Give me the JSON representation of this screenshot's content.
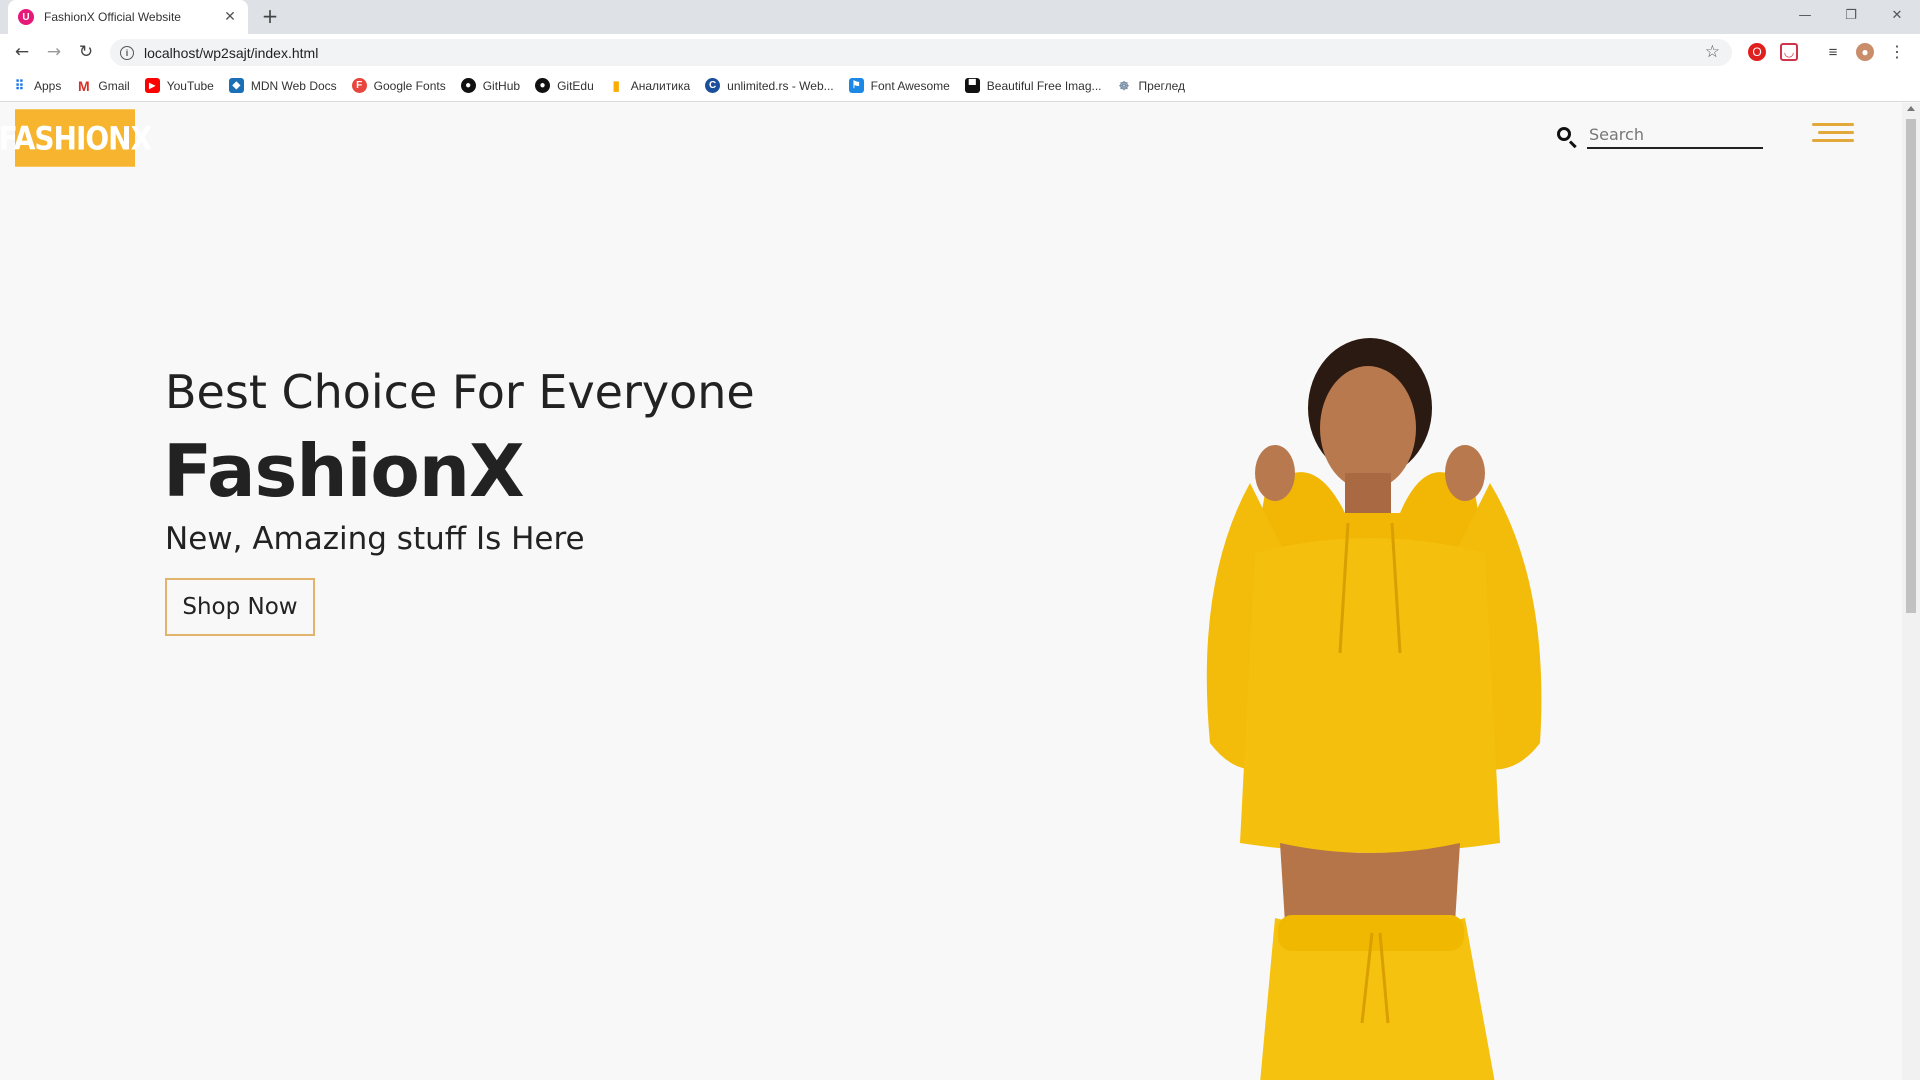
{
  "browser": {
    "tab_title": "FashionX Official Website",
    "tab_favicon_letter": "U",
    "url": "localhost/wp2sajt/index.html",
    "bookmarks": [
      {
        "label": "Apps",
        "icon": "apps-grid-icon",
        "color": "#1a73e8"
      },
      {
        "label": "Gmail",
        "icon": "gmail-icon",
        "color": "#d93025"
      },
      {
        "label": "YouTube",
        "icon": "youtube-icon",
        "color": "#ff0000"
      },
      {
        "label": "MDN Web Docs",
        "icon": "mdn-icon",
        "color": "#1b6fb5"
      },
      {
        "label": "Google Fonts",
        "icon": "google-fonts-icon",
        "color": "#e8453c"
      },
      {
        "label": "GitHub",
        "icon": "github-icon",
        "color": "#111111"
      },
      {
        "label": "GitEdu",
        "icon": "github-icon",
        "color": "#111111"
      },
      {
        "label": "Аналитика",
        "icon": "analytics-icon",
        "color": "#f9ab00"
      },
      {
        "label": "unlimited.rs - Web...",
        "icon": "unlimited-icon",
        "color": "#1b4f9c"
      },
      {
        "label": "Font Awesome",
        "icon": "font-awesome-icon",
        "color": "#1c88e5"
      },
      {
        "label": "Beautiful Free Imag...",
        "icon": "unsplash-icon",
        "color": "#111111"
      },
      {
        "label": "Преглед",
        "icon": "preview-icon",
        "color": "#7a8fa6"
      }
    ]
  },
  "site": {
    "logo_text": "FASHIONX",
    "brand_color": "#f7b52f",
    "accent_color": "#e2a83a",
    "search_placeholder": "Search"
  },
  "hero": {
    "tagline": "Best Choice For Everyone",
    "title": "FashionX",
    "subtitle": "New, Amazing stuff Is Here",
    "cta_label": "Shop Now"
  }
}
